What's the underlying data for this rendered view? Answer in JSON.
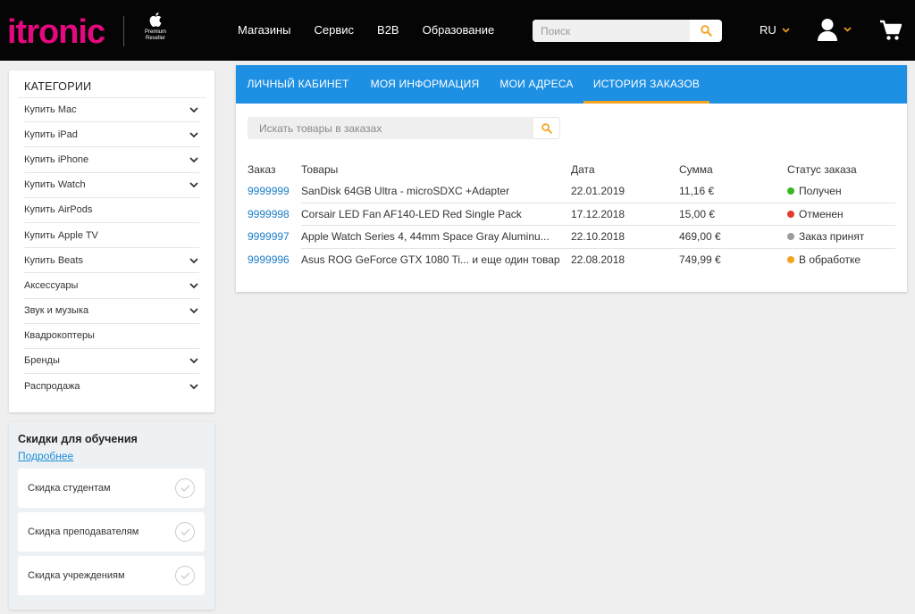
{
  "header": {
    "logo_text": "itronic",
    "reseller_line1": "Premium",
    "reseller_line2": "Reseller",
    "nav": [
      "Магазины",
      "Сервис",
      "B2B",
      "Образование"
    ],
    "search_placeholder": "Поиск",
    "language": "RU",
    "accent_color": "#f4a31e",
    "brand_color": "#e5087e"
  },
  "sidebar": {
    "title": "КАТЕГОРИИ",
    "items": [
      {
        "label": "Купить Mac",
        "expandable": true
      },
      {
        "label": "Купить iPad",
        "expandable": true
      },
      {
        "label": "Купить iPhone",
        "expandable": true
      },
      {
        "label": "Купить Watch",
        "expandable": true
      },
      {
        "label": "Купить AirPods",
        "expandable": false
      },
      {
        "label": "Купить Apple TV",
        "expandable": false
      },
      {
        "label": "Купить Beats",
        "expandable": true
      },
      {
        "label": "Аксессуары",
        "expandable": true
      },
      {
        "label": "Звук и музыка",
        "expandable": true
      },
      {
        "label": "Квадрокоптеры",
        "expandable": false
      },
      {
        "label": "Бренды",
        "expandable": true
      },
      {
        "label": "Распродажа",
        "expandable": true
      }
    ]
  },
  "discounts": {
    "title": "Скидки для обучения",
    "more_link": "Подробнее",
    "items": [
      "Скидка студентам",
      "Скидка преподавателям",
      "Скидка учреждениям"
    ]
  },
  "account": {
    "tabs": [
      {
        "label": "ЛИЧНЫЙ КАБИНЕТ",
        "active": false
      },
      {
        "label": "МОЯ ИНФОРМАЦИЯ",
        "active": false
      },
      {
        "label": "МОИ АДРЕСА",
        "active": false
      },
      {
        "label": "ИСТОРИЯ ЗАКАЗОВ",
        "active": true
      }
    ],
    "tab_color": "#1e90e3",
    "search_placeholder": "Искать товары в заказах",
    "columns": [
      "Заказ",
      "Товары",
      "Дата",
      "Сумма",
      "Статус заказа"
    ],
    "orders": [
      {
        "id": "9999999",
        "items": "SanDisk 64GB Ultra - microSDXC +Adapter",
        "date": "22.01.2019",
        "sum": "11,16 €",
        "status": "Получен",
        "status_color": "#3cb521"
      },
      {
        "id": "9999998",
        "items": "Corsair LED Fan AF140-LED Red Single Pack",
        "date": "17.12.2018",
        "sum": "15,00 €",
        "status": "Отменен",
        "status_color": "#e8392b"
      },
      {
        "id": "9999997",
        "items": "Apple Watch Series 4, 44mm Space Gray Aluminu...",
        "date": "22.10.2018",
        "sum": "469,00 €",
        "status": "Заказ принят",
        "status_color": "#9b9b9b"
      },
      {
        "id": "9999996",
        "items": "Asus ROG GeForce GTX 1080 Ti... и еще один товар",
        "date": "22.08.2018",
        "sum": "749,99 €",
        "status": "В обработке",
        "status_color": "#f4a31e"
      }
    ]
  }
}
